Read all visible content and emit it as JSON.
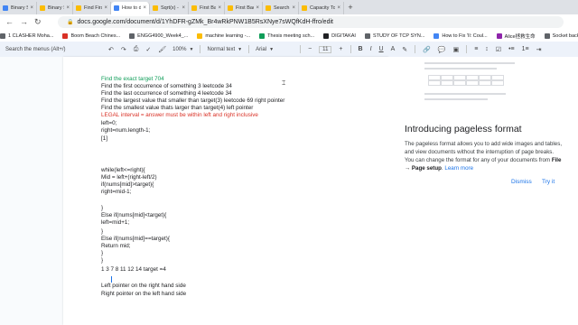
{
  "tabs": [
    {
      "label": "Binary Search",
      "color": "#4285f4"
    },
    {
      "label": "Binary Search",
      "color": "#fbbc04"
    },
    {
      "label": "Find First and",
      "color": "#fbbc04"
    },
    {
      "label": "How to do Bi",
      "color": "#4285f4",
      "active": true
    },
    {
      "label": "Sqrt(x) - Leet",
      "color": "#fbbc04"
    },
    {
      "label": "First Bad Vers",
      "color": "#fbbc04"
    },
    {
      "label": "First Bad Vers",
      "color": "#fbbc04"
    },
    {
      "label": "Search Insert",
      "color": "#fbbc04"
    },
    {
      "label": "Capacity To S",
      "color": "#fbbc04"
    }
  ],
  "address": {
    "url": "docs.google.com/document/d/1YhDFR-gZMk_Br4wRkPNW1B5RsXNye7sWQfKdH-ffro/edit"
  },
  "bookmarks": [
    {
      "label": "1 CLASHER Moha...",
      "color": "#5f6368"
    },
    {
      "label": "Boom Beach Chines...",
      "color": "#d93025"
    },
    {
      "label": "ENGG4900_Week4_...",
      "color": "#5f6368"
    },
    {
      "label": "machine learning -...",
      "color": "#fbbc04"
    },
    {
      "label": "Thesis meeting sch...",
      "color": "#0f9d58"
    },
    {
      "label": "DIGITAKAI",
      "color": "#202124"
    },
    {
      "label": "STUDY OF TCP SYN...",
      "color": "#5f6368"
    },
    {
      "label": "How to Fix 'Il: Coul...",
      "color": "#4285f4"
    },
    {
      "label": "Alice拯救生命",
      "color": "#8e24aa"
    },
    {
      "label": "Socket backlog tuni...",
      "color": "#5f6368"
    }
  ],
  "toolbar": {
    "search_menus": "Search the menus (Alt+/)",
    "zoom": "100%",
    "style": "Normal text",
    "font": "Arial",
    "font_size": "11",
    "minus": "−",
    "plus": "+",
    "bold": "B",
    "italic": "I",
    "underline": "U",
    "text_color": "A"
  },
  "doc": {
    "lines": [
      {
        "text": "Find the exact target 704",
        "style": "green"
      },
      {
        "text": "Find the first occurrence of something 3 leetcode 34",
        "style": ""
      },
      {
        "text": "Find the last occurrence of something 4 leetcode 34",
        "style": ""
      },
      {
        "text": "Find the largest value that smaller than target(3) leetcode 69 right pointer",
        "style": ""
      },
      {
        "text": "Find the smallest value thats larger than target(4)  left pointer",
        "style": ""
      },
      {
        "text": "LEGAL interval = answer must be within left and right inclusive",
        "style": "red"
      },
      {
        "text": "left=0;",
        "style": ""
      },
      {
        "text": "right=num.length-1;",
        "style": ""
      },
      {
        "text": "[1]",
        "style": ""
      },
      {
        "text": "while(left<=right){",
        "style": ""
      },
      {
        "text": "Mid = left+(right-left/2)",
        "style": ""
      },
      {
        "text": "if(nums[mid]>target){",
        "style": ""
      },
      {
        "text": "right=mid-1;",
        "style": ""
      },
      {
        "text": "}",
        "style": ""
      },
      {
        "text": "Else if(nums[mid]<target){",
        "style": ""
      },
      {
        "text": "left=mid+1;",
        "style": ""
      },
      {
        "text": "}",
        "style": ""
      },
      {
        "text": "Else if(nums[mid]==target){",
        "style": ""
      },
      {
        "text": "Return mid;",
        "style": ""
      },
      {
        "text": "}",
        "style": ""
      },
      {
        "text": "}",
        "style": ""
      },
      {
        "text": "1 3 7 8 11 12 14 target =4",
        "style": ""
      },
      {
        "text": "Left pointer on the right hand side",
        "style": ""
      },
      {
        "text": "Right pointer on the left hand side",
        "style": ""
      }
    ]
  },
  "panel": {
    "title": "Introducing pageless format",
    "text": "The pageless format allows you to add wide images and tables, and view documents without the interruption of page breaks. You can change the format for any of your documents from ",
    "path": "File → Page setup",
    "link": "Learn more",
    "dismiss": "Dismiss",
    "try": "Try it"
  }
}
